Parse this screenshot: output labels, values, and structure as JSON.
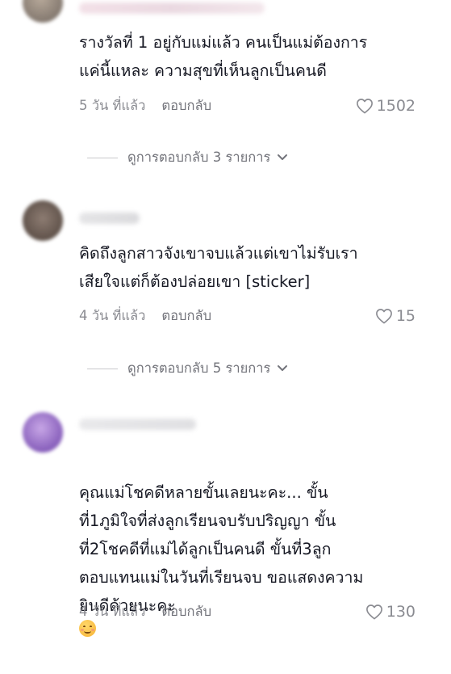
{
  "comments": [
    {
      "text": "รางวัลที่ 1 อยู่กับแม่แล้ว คนเป็นแม่ต้องการ\nแค่นี้แหละ ความสุขที่เห็นลูกเป็นคนดี",
      "time": "5 วัน ที่แล้ว",
      "reply_label": "ตอบกลับ",
      "likes": "1502",
      "view_replies": "ดูการตอบกลับ 3 รายการ"
    },
    {
      "text": "คิดถึงลูกสาวจังเขาจบแล้วแต่เขาไม่รับเรา\nเสียใจแต่ก็ต้องปล่อยเขา [sticker]",
      "time": "4 วัน ที่แล้ว",
      "reply_label": "ตอบกลับ",
      "likes": "15",
      "view_replies": "ดูการตอบกลับ 5 รายการ"
    },
    {
      "text": "คุณแม่โชคดีหลายขั้นเลยนะคะ... ขั้น\nที่1ภูมิใจที่ส่งลูกเรียนจบรับปริญญา ขั้น\nที่2โชคดีที่แม่ได้ลูกเป็นคนดี ขั้นที่3ลูก\nตอบแทนแม่ในวันที่เรียนจบ ขอแสดงความ\nยินดีด้วยนะคะ",
      "emoji": "smiling-face-emoji",
      "time": "4 วัน ที่แล้ว",
      "reply_label": "ตอบกลับ",
      "likes": "130"
    }
  ],
  "icons": {
    "like": "heart-outline-icon",
    "expand": "chevron-down-icon"
  },
  "colors": {
    "text": "#161823",
    "meta": "#8a8b91",
    "divider": "#c8c9cc"
  }
}
